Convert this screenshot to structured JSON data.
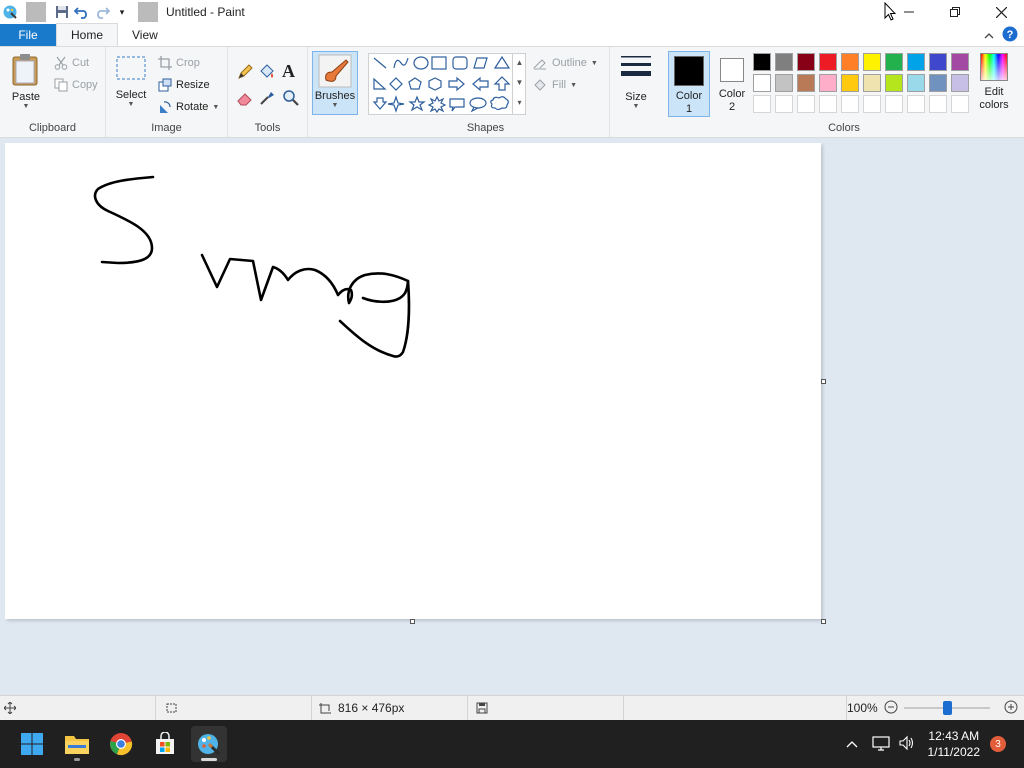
{
  "window": {
    "title": "Untitled - Paint"
  },
  "tabs": {
    "file": "File",
    "home": "Home",
    "view": "View"
  },
  "clipboard": {
    "paste": "Paste",
    "cut": "Cut",
    "copy": "Copy",
    "label": "Clipboard"
  },
  "image": {
    "select": "Select",
    "crop": "Crop",
    "resize": "Resize",
    "rotate": "Rotate",
    "label": "Image"
  },
  "tools": {
    "label": "Tools",
    "text_tool": "A"
  },
  "brushes": {
    "label": "Brushes"
  },
  "shapes": {
    "outline": "Outline",
    "fill": "Fill",
    "label": "Shapes"
  },
  "size": {
    "label": "Size"
  },
  "colors": {
    "color1_label": "Color 1",
    "color2_label": "Color 2",
    "edit_label": "Edit colors",
    "label": "Colors",
    "color1": "#000000",
    "color2": "#ffffff",
    "palette_row1": [
      "#000000",
      "#7f7f7f",
      "#880015",
      "#ed1c24",
      "#ff7f27",
      "#fff200",
      "#22b14c",
      "#00a2e8",
      "#3f48cc",
      "#a349a4"
    ],
    "palette_row2": [
      "#ffffff",
      "#c3c3c3",
      "#b97a57",
      "#ffaec9",
      "#ffc90e",
      "#efe4b0",
      "#b5e61d",
      "#99d9ea",
      "#7092be",
      "#c8bfe7"
    ]
  },
  "status": {
    "canvas_size": "816 × 476px",
    "zoom": "100%",
    "zoom_level": 0.5
  },
  "taskbar": {
    "time": "12:43 AM",
    "date": "1/11/2022",
    "notifications": "3"
  }
}
